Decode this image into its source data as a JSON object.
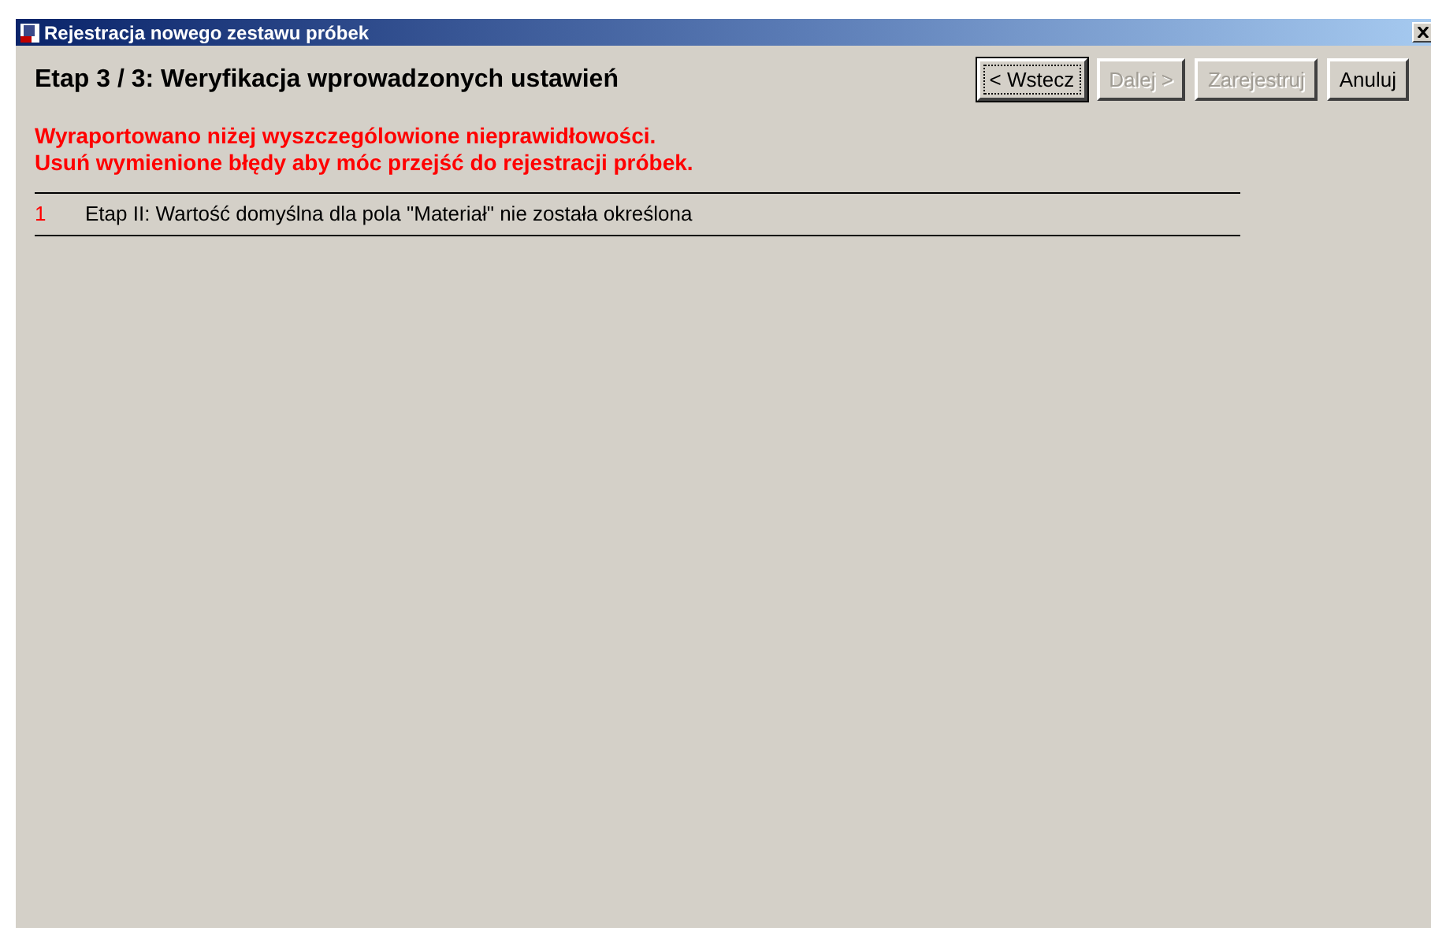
{
  "window": {
    "title": "Rejestracja nowego zestawu próbek"
  },
  "heading": "Etap 3 / 3: Weryfikacja wprowadzonych ustawień",
  "buttons": [
    {
      "label": "< Wstecz",
      "disabled": false,
      "focused": true
    },
    {
      "label": "Dalej >",
      "disabled": true,
      "focused": false
    },
    {
      "label": "Zarejestruj",
      "disabled": true,
      "focused": false
    },
    {
      "label": "Anuluj",
      "disabled": false,
      "focused": false
    }
  ],
  "error_message": [
    "Wyraportowano niżej wyszczególowione nieprawidłowości.",
    "Usuń wymienione błędy aby móc przejść do rejestracji próbek."
  ],
  "errors": [
    {
      "number": "1",
      "text": "Etap II: Wartość domyślna dla pola \"Materiał\" nie została określona"
    }
  ]
}
